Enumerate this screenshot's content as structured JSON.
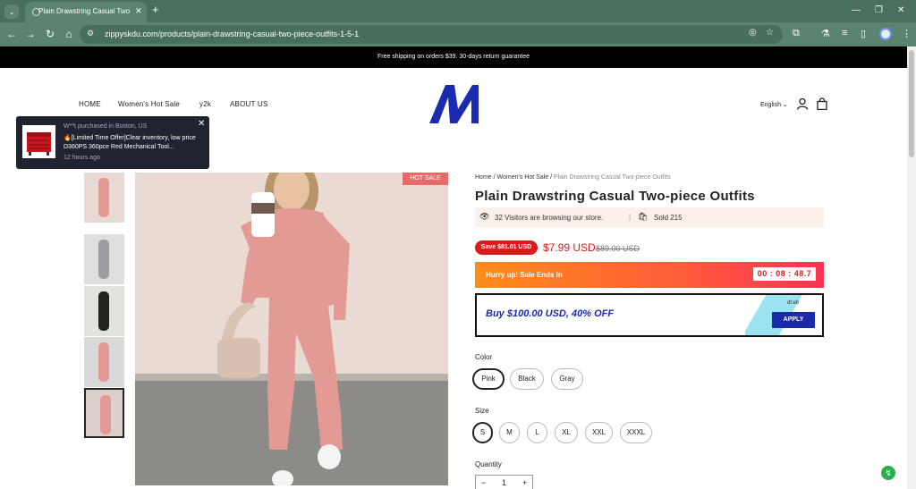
{
  "browser": {
    "tab_title": "Plain Drawstring Casual Two-pi",
    "url": "zippyskdu.com/products/plain-drawstring-casual-two-piece-outfits-1-5-1",
    "icons": {
      "tab_dropdown": "chevron-down-icon",
      "close_tab": "close-icon",
      "new_tab": "plus-icon",
      "back": "back-arrow-icon",
      "forward": "forward-arrow-icon",
      "reload": "reload-icon",
      "home": "home-icon",
      "site_info": "site-info-icon",
      "hide": "eye-off-icon",
      "bookmark": "star-icon",
      "extensions": "puzzle-icon",
      "profile": "profile-icon",
      "menu": "kebab-menu-icon"
    }
  },
  "announcement": "Free shipping on orders $39. 30-days return guarantee",
  "nav": {
    "items": [
      "HOME",
      "Women's Hot Sale",
      "y2k",
      "ABOUT US"
    ],
    "language": "English",
    "logo_letter": "M"
  },
  "popup": {
    "who": "W**t purchased in Boston, US",
    "product": "🔥[Limited Time Offer]Clear inventory, low price D360PS 360pce Red Mechanical Tool...",
    "time": "12 hours ago",
    "close": "✕"
  },
  "gallery": {
    "hot_badge": "HOT SALE",
    "thumbnails": [
      {
        "label": "pink outfit",
        "color": "#e39a95",
        "bg": "#e9d9d4"
      },
      {
        "label": "gray outfit",
        "color": "#9a9ea3",
        "bg": "#dfe0de"
      },
      {
        "label": "black outfit",
        "color": "#222222",
        "bg": "#e4e2df"
      },
      {
        "label": "pink outfit pair",
        "color": "#e39a95",
        "bg": "#d9d9d9"
      },
      {
        "label": "pink outfit selected",
        "color": "#e39a95",
        "bg": "#ddd0cc"
      }
    ]
  },
  "product": {
    "breadcrumb": {
      "home": "Home",
      "sep": " / ",
      "category": "Women's Hot Sale",
      "current": "Plain Drawstring Casual Two-piece Outfits"
    },
    "title": "Plain Drawstring Casual Two-piece Outfits",
    "visitors_text": "32 Visitors are browsing our store.",
    "sold_text": "Sold 215",
    "save_badge": "Save $81.01 USD",
    "price": "$7.99 USD",
    "compare_price": "$89.00 USD",
    "hurry_text": "Hurry up! Sale Ends in",
    "timer": "00 : 08 : 48.7",
    "promo_text": "Buy $100.00 USD, 40% OFF",
    "promo_hint": "dt:eb",
    "apply": "APPLY",
    "color_label": "Color",
    "colors": [
      "Pink",
      "Black",
      "Gray"
    ],
    "selected_color": "Pink",
    "size_label": "Size",
    "sizes": [
      "S",
      "M",
      "L",
      "XL",
      "XXL",
      "XXXL"
    ],
    "selected_size": "S",
    "quantity_label": "Quantity",
    "quantity": "1",
    "minus": "−",
    "plus": "+"
  },
  "colors": {
    "accent_red": "#d81c1c",
    "promo_blue": "#1a2aa8",
    "chrome_green": "#48705d"
  }
}
